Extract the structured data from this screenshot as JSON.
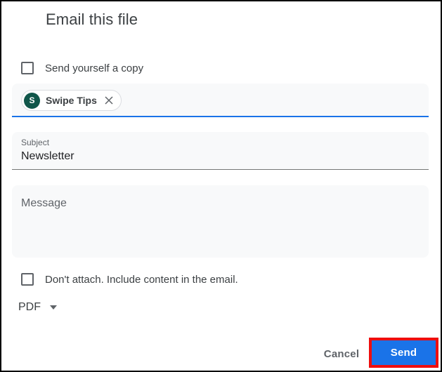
{
  "dialog": {
    "title": "Email this file",
    "send_copy": {
      "label": "Send yourself a copy",
      "checked": false
    },
    "recipients": {
      "chip": {
        "avatar_initial": "S",
        "name": "Swipe Tips"
      }
    },
    "subject": {
      "label": "Subject",
      "value": "Newsletter"
    },
    "message": {
      "placeholder": "Message"
    },
    "dont_attach": {
      "label": "Don't attach. Include content in the email.",
      "checked": false
    },
    "format_select": {
      "value": "PDF"
    },
    "footer": {
      "cancel_label": "Cancel",
      "send_label": "Send"
    }
  },
  "colors": {
    "accent_blue": "#1a73e8",
    "field_background": "#f8f9fa",
    "avatar_green": "#10564a",
    "annotation_red": "#ee0e0e",
    "text_primary": "#3c4043",
    "text_secondary": "#5f6368",
    "chip_border": "#dadce0",
    "frame_border": "#000000"
  }
}
